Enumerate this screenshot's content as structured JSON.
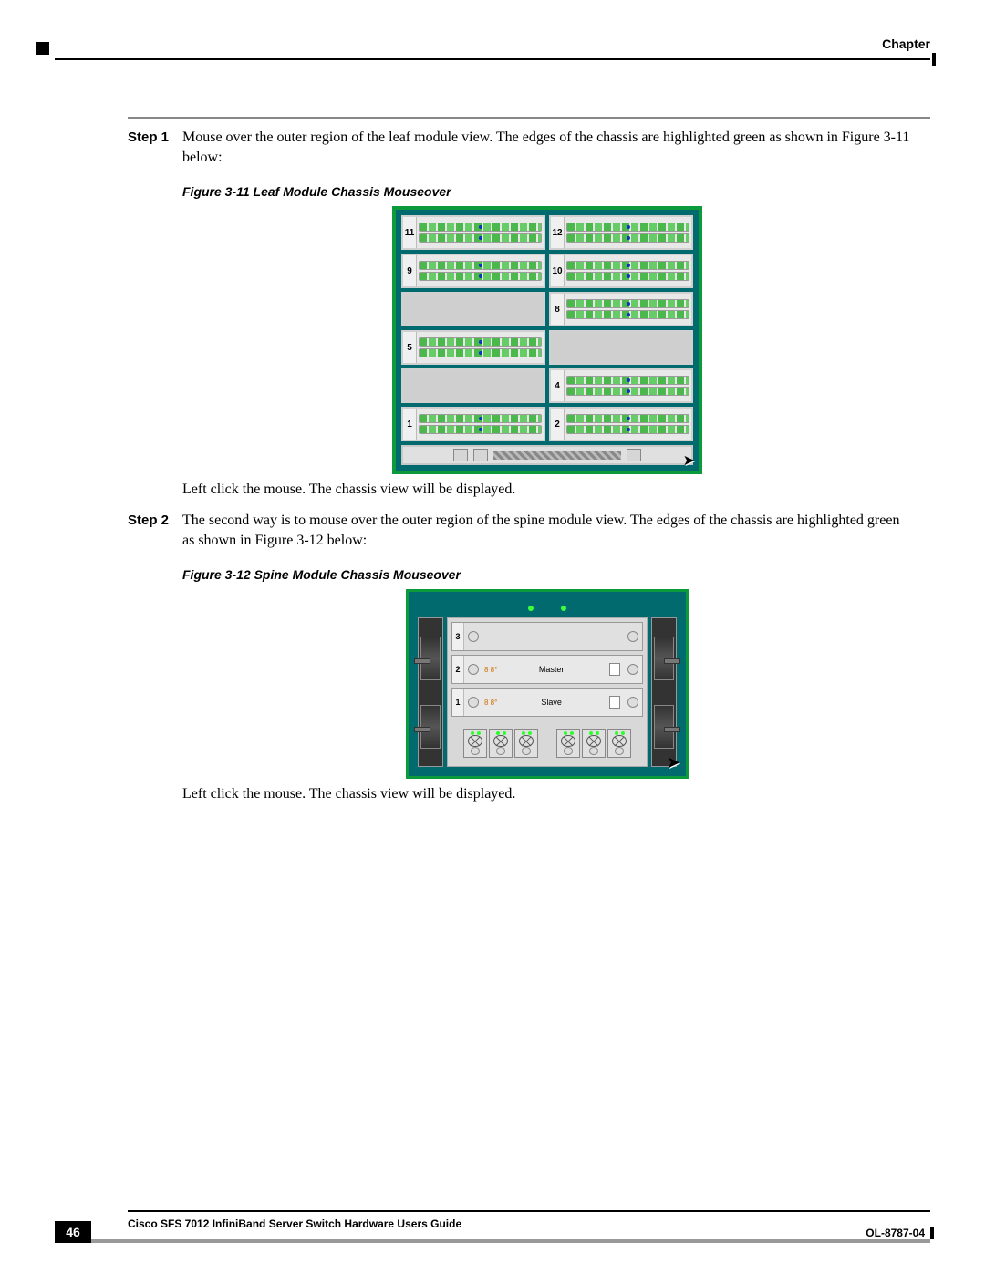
{
  "header": {
    "chapter_label": "Chapter"
  },
  "steps": [
    {
      "label": "Step 1",
      "text": "Mouse over the outer region of the leaf module view. The edges of the chassis are highlighted green as shown in Figure 3-11 below:"
    },
    {
      "label": "Step 2",
      "text": "The second way is to mouse over the outer region of the spine module view. The edges of the chassis are highlighted green as shown in Figure 3-12 below:"
    }
  ],
  "figures": [
    {
      "caption": "Figure 3-11    Leaf Module Chassis Mouseover",
      "after_text": "Left click the mouse. The chassis view will be displayed.",
      "slots": [
        {
          "num": "11",
          "filled": true
        },
        {
          "num": "12",
          "filled": true
        },
        {
          "num": "9",
          "filled": true
        },
        {
          "num": "10",
          "filled": true
        },
        {
          "num": "",
          "filled": false
        },
        {
          "num": "8",
          "filled": true
        },
        {
          "num": "5",
          "filled": true
        },
        {
          "num": "",
          "filled": false
        },
        {
          "num": "",
          "filled": false
        },
        {
          "num": "4",
          "filled": true
        },
        {
          "num": "1",
          "filled": true
        },
        {
          "num": "2",
          "filled": true
        }
      ]
    },
    {
      "caption": "Figure 3-12    Spine Module Chassis Mouseover",
      "after_text": "Left click the mouse. The chassis view will be displayed.",
      "slots": [
        {
          "num": "3",
          "label": "",
          "filled": false,
          "eighty": ""
        },
        {
          "num": "2",
          "label": "Master",
          "filled": true,
          "eighty": "8 8°"
        },
        {
          "num": "1",
          "label": "Slave",
          "filled": true,
          "eighty": "8 8°"
        }
      ]
    }
  ],
  "footer": {
    "doc_title": "Cisco SFS 7012 InfiniBand Server Switch Hardware Users Guide",
    "page_number": "46",
    "doc_number": "OL-8787-04"
  }
}
